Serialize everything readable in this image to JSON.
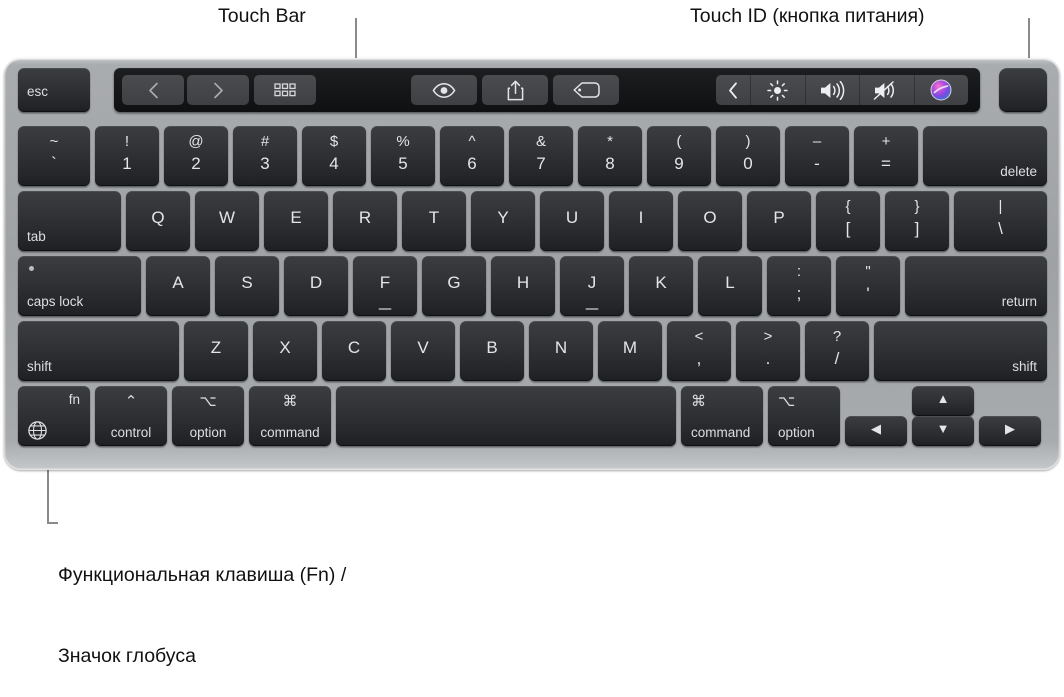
{
  "callouts": {
    "touch_bar": "Touch Bar",
    "touch_id": "Touch ID (кнопка питания)",
    "fn_line1": "Функциональная клавиша (Fn) /",
    "fn_line2": "Значок глобуса"
  },
  "colors": {
    "chassis": "#9fa2a5",
    "key_face": "#313337",
    "key_text": "#e3e5e7",
    "touchbar_bg": "#141618",
    "touchbar_button": "#44464a",
    "siri_purple": "#b24ad8",
    "siri_pink": "#e95fa0",
    "siri_blue": "#3aa0e8",
    "callout_text": "#111111",
    "leader_line": "#8a8a8a"
  },
  "touch_bar": {
    "app_region_buttons": [
      {
        "name": "back-icon",
        "glyph": "chevron-left"
      },
      {
        "name": "forward-icon",
        "glyph": "chevron-right"
      },
      {
        "name": "grid-view-icon",
        "glyph": "grid-dots"
      }
    ],
    "center_buttons": [
      {
        "name": "quick-look-icon",
        "glyph": "eye"
      },
      {
        "name": "share-icon",
        "glyph": "share-up-arrow"
      },
      {
        "name": "tag-icon",
        "glyph": "tag"
      }
    ],
    "control_strip": [
      {
        "name": "expand-control-strip-icon",
        "glyph": "chevron-left"
      },
      {
        "name": "brightness-icon",
        "glyph": "sun"
      },
      {
        "name": "volume-up-icon",
        "glyph": "speaker-waves"
      },
      {
        "name": "mute-icon",
        "glyph": "speaker-muted"
      },
      {
        "name": "siri-icon",
        "glyph": "siri-orb"
      }
    ]
  },
  "touch_id_key": {
    "label": ""
  },
  "rows": {
    "escape_row": [
      {
        "name": "esc",
        "label": "esc"
      }
    ],
    "number_row": [
      {
        "name": "backtick",
        "top": "~",
        "bottom": "`"
      },
      {
        "name": "one",
        "top": "!",
        "bottom": "1"
      },
      {
        "name": "two",
        "top": "@",
        "bottom": "2"
      },
      {
        "name": "three",
        "top": "#",
        "bottom": "3"
      },
      {
        "name": "four",
        "top": "$",
        "bottom": "4"
      },
      {
        "name": "five",
        "top": "%",
        "bottom": "5"
      },
      {
        "name": "six",
        "top": "^",
        "bottom": "6"
      },
      {
        "name": "seven",
        "top": "&",
        "bottom": "7"
      },
      {
        "name": "eight",
        "top": "*",
        "bottom": "8"
      },
      {
        "name": "nine",
        "top": "(",
        "bottom": "9"
      },
      {
        "name": "zero",
        "top": ")",
        "bottom": "0"
      },
      {
        "name": "minus",
        "top": "–",
        "bottom": "-"
      },
      {
        "name": "equals",
        "top": "+",
        "bottom": "="
      },
      {
        "name": "delete",
        "label": "delete"
      }
    ],
    "tab_row": [
      {
        "name": "tab",
        "label": "tab"
      },
      {
        "name": "q",
        "label": "Q"
      },
      {
        "name": "w",
        "label": "W"
      },
      {
        "name": "e",
        "label": "E"
      },
      {
        "name": "r",
        "label": "R"
      },
      {
        "name": "t",
        "label": "T"
      },
      {
        "name": "y",
        "label": "Y"
      },
      {
        "name": "u",
        "label": "U"
      },
      {
        "name": "i",
        "label": "I"
      },
      {
        "name": "o",
        "label": "O"
      },
      {
        "name": "p",
        "label": "P"
      },
      {
        "name": "bracket-left",
        "top": "{",
        "bottom": "["
      },
      {
        "name": "bracket-right",
        "top": "}",
        "bottom": "]"
      },
      {
        "name": "backslash",
        "top": "|",
        "bottom": "\\"
      }
    ],
    "home_row": [
      {
        "name": "caps-lock",
        "label": "caps lock"
      },
      {
        "name": "a",
        "label": "A"
      },
      {
        "name": "s",
        "label": "S"
      },
      {
        "name": "d",
        "label": "D"
      },
      {
        "name": "f",
        "label": "F"
      },
      {
        "name": "g",
        "label": "G"
      },
      {
        "name": "h",
        "label": "H"
      },
      {
        "name": "j",
        "label": "J"
      },
      {
        "name": "k",
        "label": "K"
      },
      {
        "name": "l",
        "label": "L"
      },
      {
        "name": "semicolon",
        "top": ":",
        "bottom": ";"
      },
      {
        "name": "quote",
        "top": "\"",
        "bottom": "'"
      },
      {
        "name": "return",
        "label": "return"
      }
    ],
    "shift_row": [
      {
        "name": "shift-left",
        "label": "shift"
      },
      {
        "name": "z",
        "label": "Z"
      },
      {
        "name": "x",
        "label": "X"
      },
      {
        "name": "c",
        "label": "C"
      },
      {
        "name": "v",
        "label": "V"
      },
      {
        "name": "b",
        "label": "B"
      },
      {
        "name": "n",
        "label": "N"
      },
      {
        "name": "m",
        "label": "M"
      },
      {
        "name": "comma",
        "top": "<",
        "bottom": ","
      },
      {
        "name": "period",
        "top": ">",
        "bottom": "."
      },
      {
        "name": "slash",
        "top": "?",
        "bottom": "/"
      },
      {
        "name": "shift-right",
        "label": "shift"
      }
    ],
    "bottom_row": [
      {
        "name": "fn",
        "label": "fn",
        "icon": "globe-icon"
      },
      {
        "name": "control-left",
        "symbol": "⌃",
        "label": "control"
      },
      {
        "name": "option-left",
        "symbol": "⌥",
        "label": "option"
      },
      {
        "name": "command-left",
        "symbol": "⌘",
        "label": "command"
      },
      {
        "name": "space",
        "label": ""
      },
      {
        "name": "command-right",
        "symbol": "⌘",
        "label": "command"
      },
      {
        "name": "option-right",
        "symbol": "⌥",
        "label": "option"
      },
      {
        "name": "arrow-left",
        "label": "◀"
      },
      {
        "name": "arrow-up",
        "label": "▲"
      },
      {
        "name": "arrow-down",
        "label": "▼"
      },
      {
        "name": "arrow-right",
        "label": "▶"
      }
    ]
  }
}
